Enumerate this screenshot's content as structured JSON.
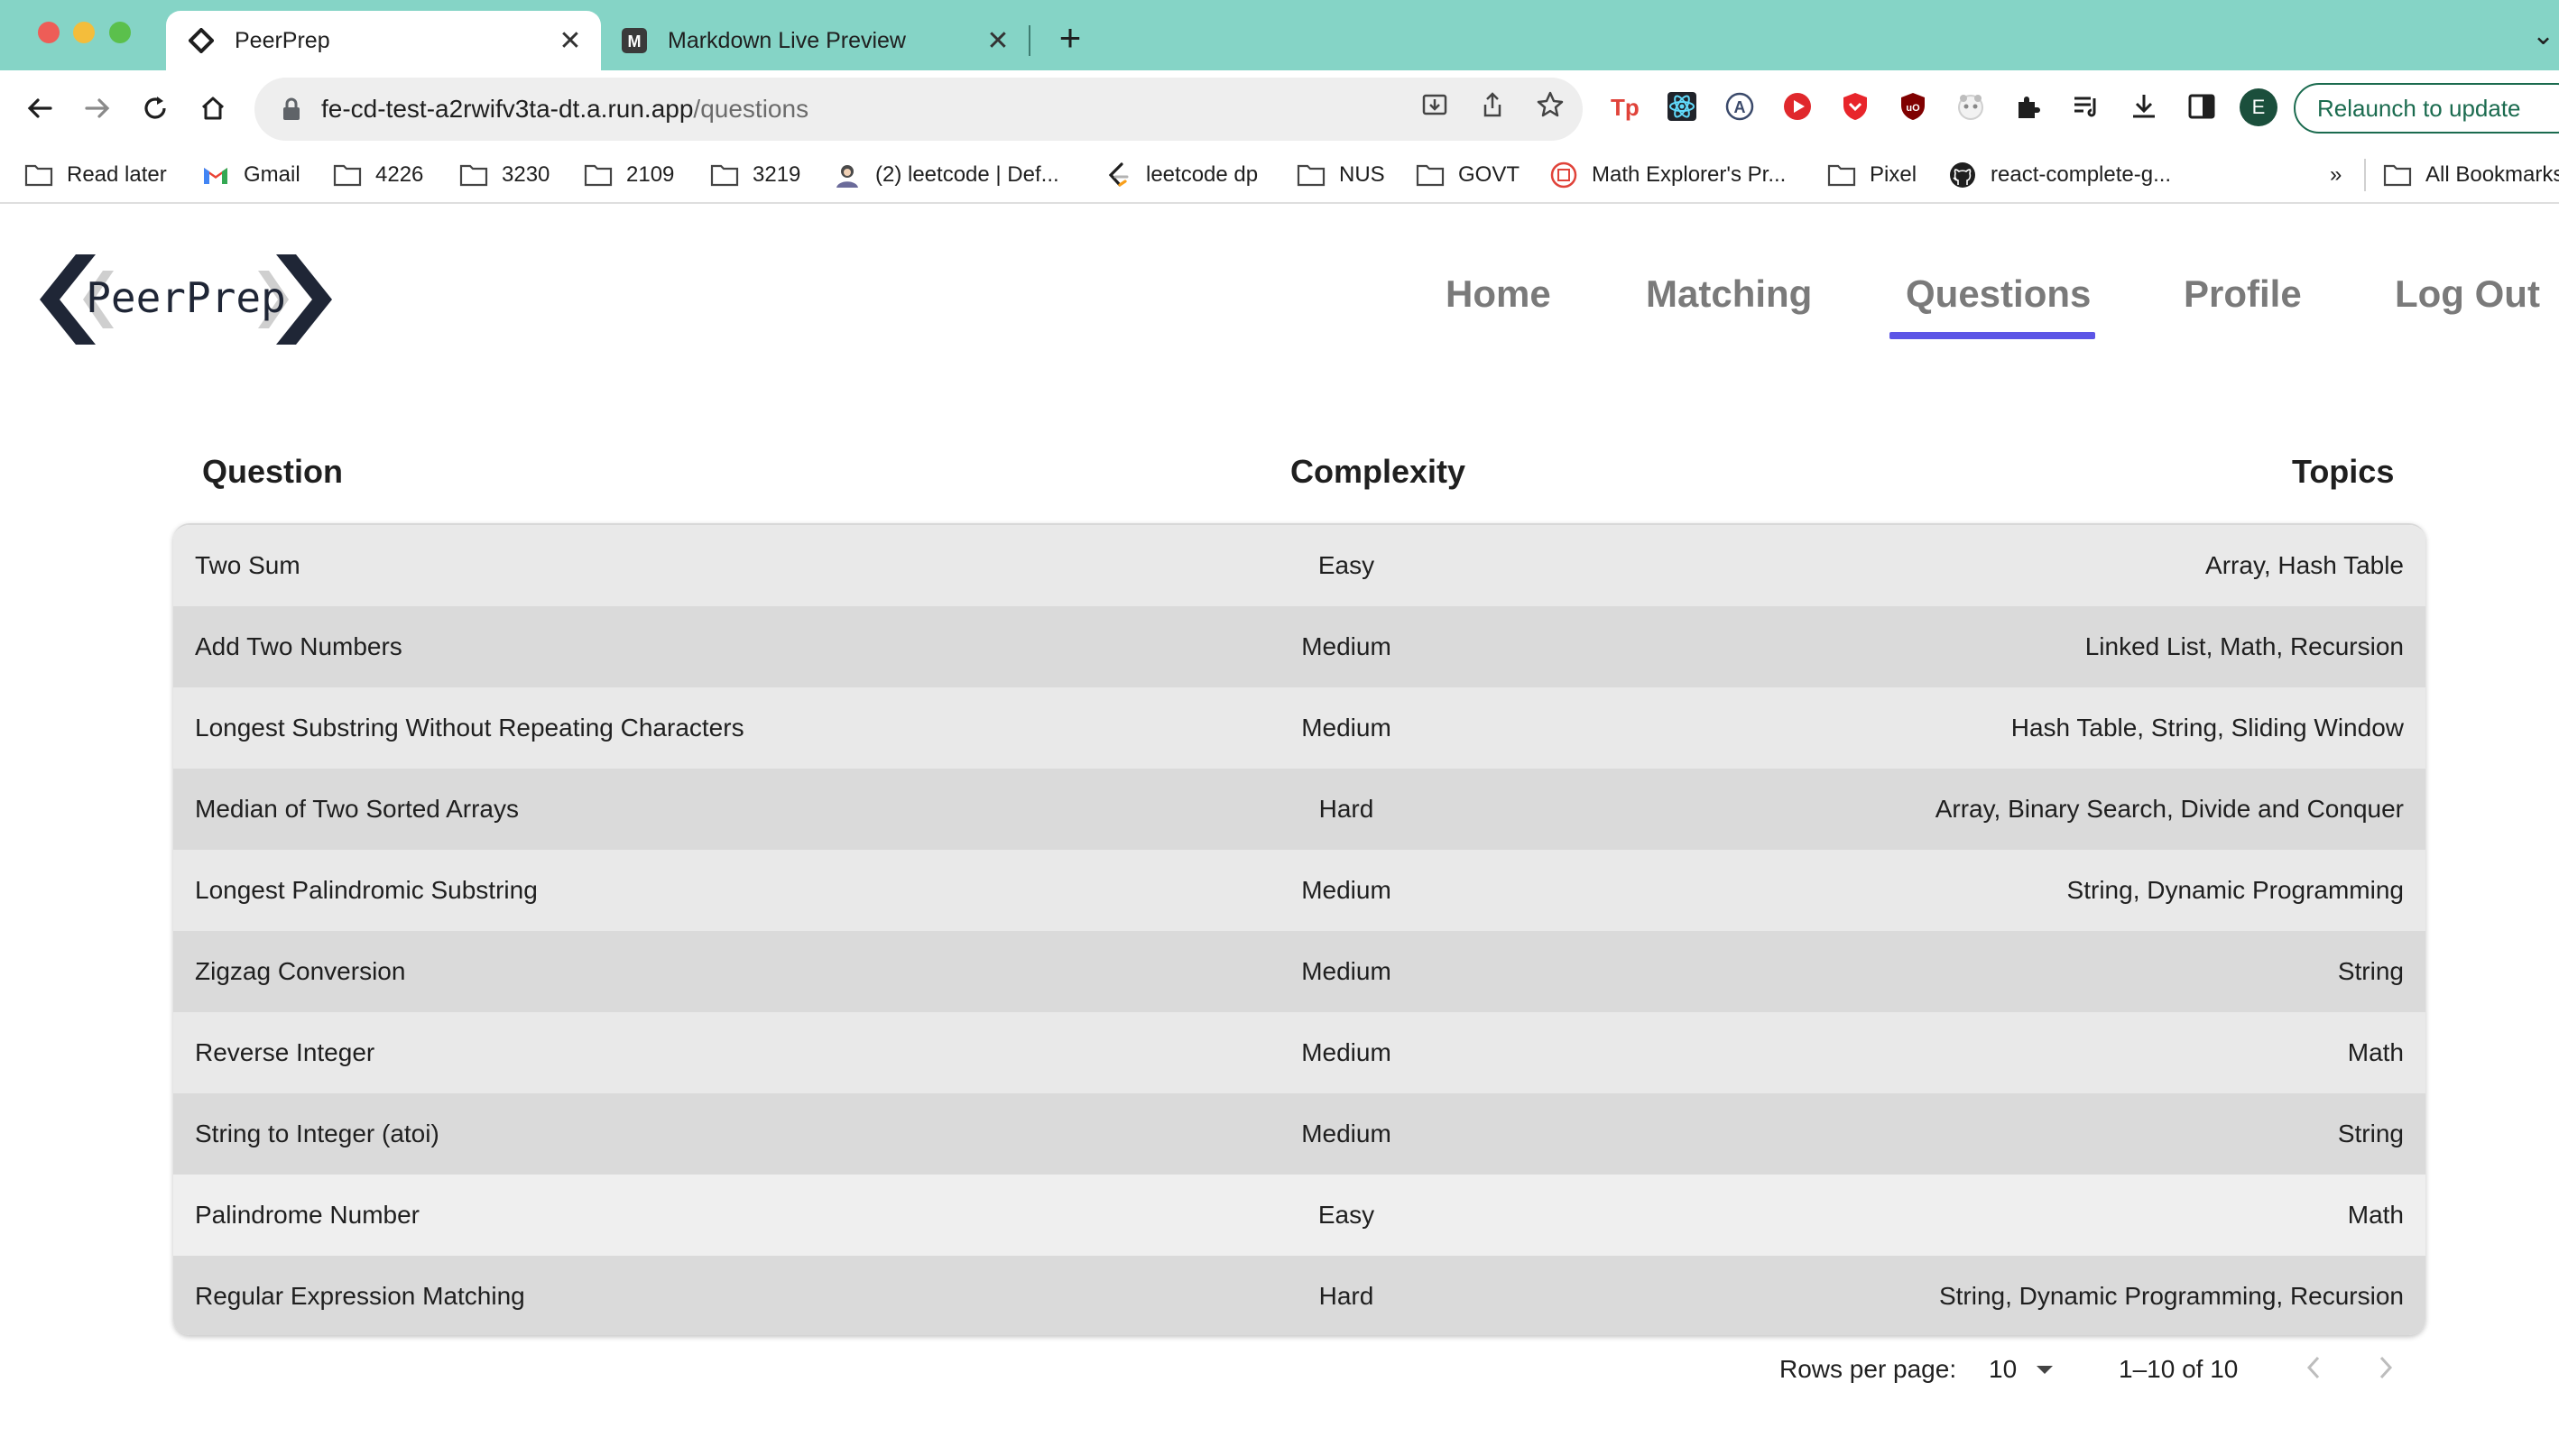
{
  "browser": {
    "tabs": [
      {
        "title": "PeerPrep",
        "active": true
      },
      {
        "title": "Markdown Live Preview",
        "active": false
      }
    ],
    "url_host": "fe-cd-test-a2rwifv3ta-dt.a.run.app",
    "url_path": "/questions",
    "relaunch_label": "Relaunch to update",
    "profile_initial": "E",
    "bookmarks": [
      {
        "label": "Read later",
        "icon": "folder-icon"
      },
      {
        "label": "Gmail",
        "icon": "gmail-icon"
      },
      {
        "label": "4226",
        "icon": "folder-icon"
      },
      {
        "label": "3230",
        "icon": "folder-icon"
      },
      {
        "label": "2109",
        "icon": "folder-icon"
      },
      {
        "label": "3219",
        "icon": "folder-icon"
      },
      {
        "label": "(2) leetcode | Def...",
        "icon": "avatar-icon"
      },
      {
        "label": "leetcode dp",
        "icon": "leetcode-icon"
      },
      {
        "label": "NUS",
        "icon": "folder-icon"
      },
      {
        "label": "GOVT",
        "icon": "folder-icon"
      },
      {
        "label": "Math Explorer's Pr...",
        "icon": "math-explorer-icon"
      },
      {
        "label": "Pixel",
        "icon": "folder-icon"
      },
      {
        "label": "react-complete-g...",
        "icon": "github-icon"
      }
    ],
    "bookmarks_overflow": "»",
    "all_bookmarks": "All Bookmarks"
  },
  "app": {
    "logo_text": "PeerPrep",
    "nav": [
      {
        "label": "Home"
      },
      {
        "label": "Matching"
      },
      {
        "label": "Questions",
        "active": true
      },
      {
        "label": "Profile"
      },
      {
        "label": "Log Out"
      }
    ],
    "accent_color": "#5c55e6"
  },
  "table": {
    "headers": {
      "question": "Question",
      "complexity": "Complexity",
      "topics": "Topics"
    },
    "rows": [
      {
        "question": "Two Sum",
        "complexity": "Easy",
        "topics": "Array, Hash Table"
      },
      {
        "question": "Add Two Numbers",
        "complexity": "Medium",
        "topics": "Linked List, Math, Recursion"
      },
      {
        "question": "Longest Substring Without Repeating Characters",
        "complexity": "Medium",
        "topics": "Hash Table, String, Sliding Window"
      },
      {
        "question": "Median of Two Sorted Arrays",
        "complexity": "Hard",
        "topics": "Array, Binary Search, Divide and Conquer"
      },
      {
        "question": "Longest Palindromic Substring",
        "complexity": "Medium",
        "topics": "String, Dynamic Programming"
      },
      {
        "question": "Zigzag Conversion",
        "complexity": "Medium",
        "topics": "String"
      },
      {
        "question": "Reverse Integer",
        "complexity": "Medium",
        "topics": "Math"
      },
      {
        "question": "String to Integer (atoi)",
        "complexity": "Medium",
        "topics": "String"
      },
      {
        "question": "Palindrome Number",
        "complexity": "Easy",
        "topics": "Math"
      },
      {
        "question": "Regular Expression Matching",
        "complexity": "Hard",
        "topics": "String, Dynamic Programming, Recursion"
      }
    ]
  },
  "pagination": {
    "rows_per_page_label": "Rows per page:",
    "rows_per_page_value": "10",
    "range_label": "1–10 of 10"
  }
}
